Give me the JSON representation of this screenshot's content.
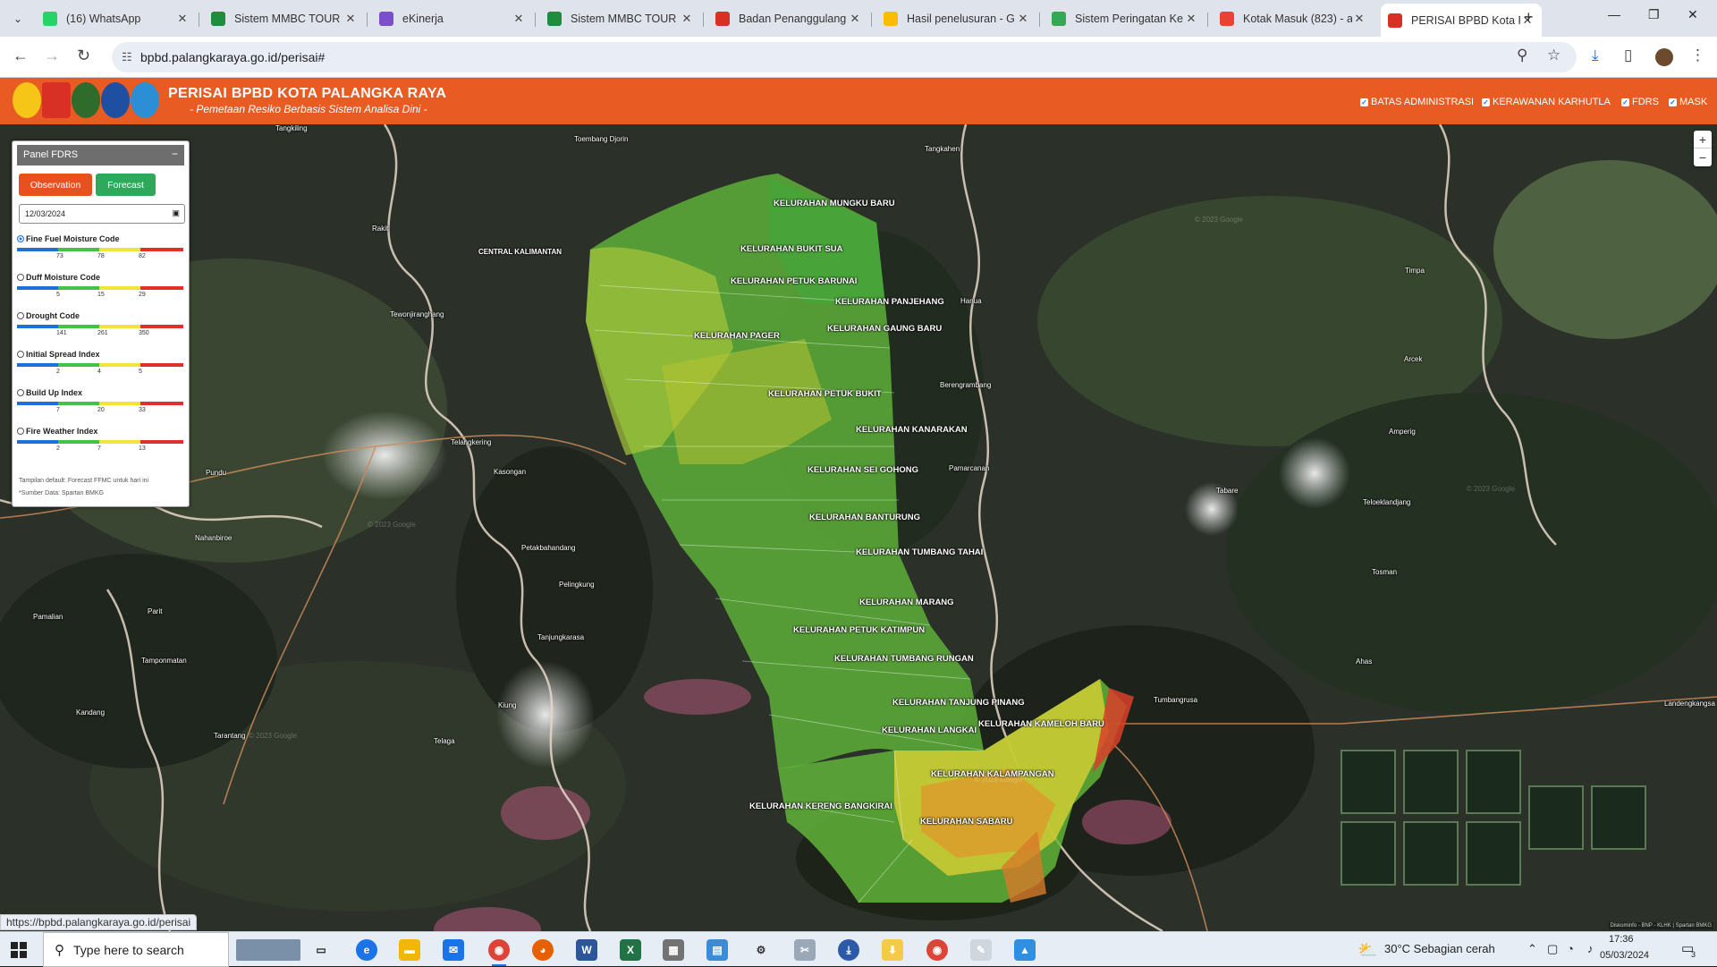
{
  "browser": {
    "tabs": [
      {
        "title": "(16) WhatsApp",
        "icon": "whatsapp-icon",
        "color": "#25d366"
      },
      {
        "title": "Sistem MMBC TOUR",
        "icon": "sheets-icon",
        "color": "#1e8e3e"
      },
      {
        "title": "eKinerja",
        "icon": "ekinerja-icon",
        "color": "#7b4fc9"
      },
      {
        "title": "Sistem MMBC TOUR",
        "icon": "sheets-icon",
        "color": "#1e8e3e"
      },
      {
        "title": "Badan Penanggulang",
        "icon": "bpbd-icon",
        "color": "#d93025"
      },
      {
        "title": "Hasil penelusuran - G",
        "icon": "drive-icon",
        "color": "#fbbc04"
      },
      {
        "title": "Sistem Peringatan Ke",
        "icon": "warning-site-icon",
        "color": "#34a853"
      },
      {
        "title": "Kotak Masuk (823) - a",
        "icon": "gmail-icon",
        "color": "#ea4335"
      },
      {
        "title": "PERISAI BPBD Kota P",
        "icon": "bpbd-icon",
        "color": "#d93025",
        "active": true
      }
    ],
    "url": "bpbd.palangkaraya.go.id/perisai#",
    "status_url": "https://bpbd.palangkaraya.go.id/perisai"
  },
  "header": {
    "title": "PERISAI BPBD KOTA PALANGKA RAYA",
    "subtitle": "- Pemetaan Resiko Berbasis Sistem Analisa Dini -",
    "logo_captions": [
      "Palangka Raya",
      "BPBD Kota Palangka Raya",
      "Kalimantan",
      "Provinsi",
      "BMKG"
    ],
    "layers": [
      "BATAS ADMINISTRASI",
      "KERAWANAN KARHUTLA",
      "FDRS",
      "MASK"
    ]
  },
  "panel": {
    "title": "Panel FDRS",
    "minimize": "−",
    "observation_label": "Observation",
    "forecast_label": "Forecast",
    "date": "12/03/2024",
    "indices": [
      {
        "name": "Fine Fuel Moisture Code",
        "selected": true,
        "ticks": [
          "73",
          "78",
          "82"
        ]
      },
      {
        "name": "Duff Moisture Code",
        "selected": false,
        "ticks": [
          "5",
          "15",
          "29"
        ]
      },
      {
        "name": "Drought Code",
        "selected": false,
        "ticks": [
          "141",
          "261",
          "350"
        ]
      },
      {
        "name": "Initial Spread Index",
        "selected": false,
        "ticks": [
          "2",
          "4",
          "5"
        ]
      },
      {
        "name": "Build Up Index",
        "selected": false,
        "ticks": [
          "7",
          "20",
          "33"
        ]
      },
      {
        "name": "Fire Weather Index",
        "selected": false,
        "ticks": [
          "2",
          "7",
          "13"
        ]
      }
    ],
    "note1": "Tampilan default: Forecast FFMC untuk hari ini",
    "note2": "*Sumber Data: Spartan BMKG",
    "scale_colors": [
      "#1e6fd9",
      "#43c24a",
      "#f2e43a",
      "#e0302b"
    ]
  },
  "map": {
    "kelurahan": [
      "KELURAHAN MUNGKU BARU",
      "KELURAHAN BUKIT SUA",
      "KELURAHAN PETUK BARUNAI",
      "KELURAHAN PANJEHANG",
      "KELURAHAN GAUNG BARU",
      "KELURAHAN PAGER",
      "KELURAHAN PETUK BUKIT",
      "KELURAHAN KANARAKAN",
      "KELURAHAN SEI GOHONG",
      "KELURAHAN BANTURUNG",
      "KELURAHAN TUMBANG TAHAI",
      "KELURAHAN MARANG",
      "KELURAHAN PETUK KATIMPUN",
      "KELURAHAN TUMBANG RUNGAN",
      "KELURAHAN TANJUNG PINANG",
      "KELURAHAN LANGKAI",
      "KELURAHAN KAMELOH BARU",
      "KELURAHAN KALAMPANGAN",
      "KELURAHAN KERENG BANGKIRAI",
      "KELURAHAN SABARU"
    ],
    "places": [
      "Tangkiling",
      "Toembang Djorin",
      "Tangkahen",
      "Rakit",
      "CENTRAL KALIMANTAN",
      "Tewonjiranghang",
      "Hanua",
      "Timpa",
      "Arcek",
      "Berengrambang",
      "Telangkering",
      "Amperig",
      "Kasongan",
      "Pundu",
      "Pamarcanan",
      "Tabare",
      "Teloeklandjang",
      "Nahanbiroe",
      "Petakbahandang",
      "Tosman",
      "Parit",
      "Pelingkung",
      "Tamponmatan",
      "Pamalian",
      "Tanjungkarasa",
      "Ahas",
      "Tumbangrusa",
      "Landengkangsa",
      "Kandang",
      "Tarantang",
      "Telaga",
      "Kiung"
    ],
    "watermark": "© 2023 Google",
    "zoom_in": "+",
    "zoom_out": "−",
    "attribution": "Diskominfo - BNP - KLHK | Spartan BMKG"
  },
  "taskbar": {
    "search_placeholder": "Type here to search",
    "weather": "30°C  Sebagian cerah",
    "time": "17:36",
    "date": "05/03/2024",
    "notifications": "3"
  }
}
